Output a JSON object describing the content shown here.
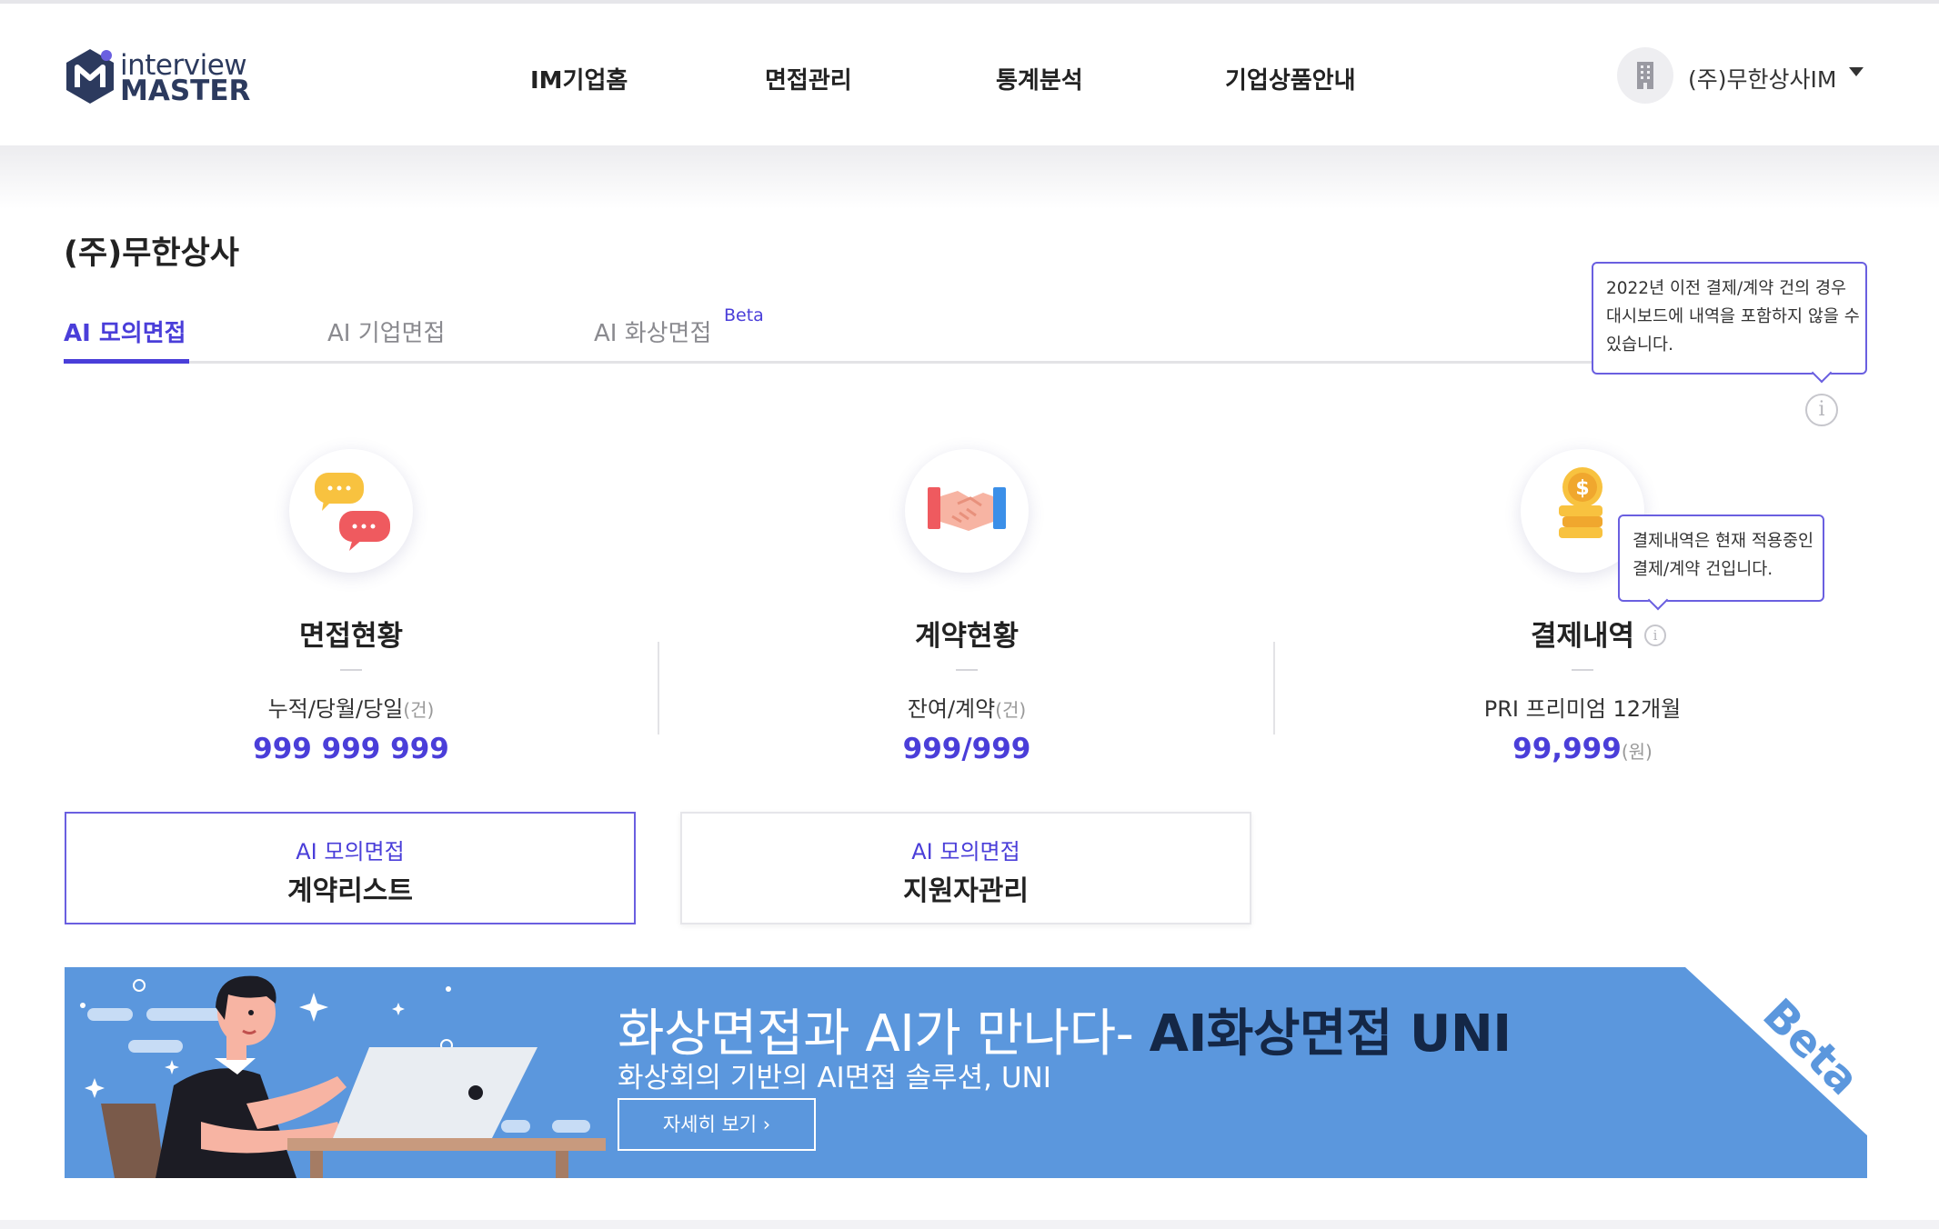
{
  "header": {
    "logo": {
      "line1": "interview",
      "line2": "MASTER"
    },
    "nav": [
      "IM기업홈",
      "면접관리",
      "통계분석",
      "기업상품안내"
    ],
    "account_name": "(주)무한상사IM"
  },
  "company_name": "(주)무한상사",
  "tabs": [
    {
      "label": "AI 모의면접",
      "active": true
    },
    {
      "label": "AI 기업면접",
      "active": false
    },
    {
      "label": "AI 화상면접",
      "active": false,
      "badge": "Beta"
    }
  ],
  "tooltips": {
    "dashboard_notice": [
      "2022년 이전 결제/계약 건의 경우",
      "대시보드에 내역을 포함하지 않을 수",
      "있습니다."
    ],
    "payment_notice": [
      "결제내역은 현재 적용중인",
      "결제/계약 건입니다."
    ]
  },
  "stats": [
    {
      "title": "면접현황",
      "subtitle": "누적/당월/당일",
      "sub_unit": "(건)",
      "value": "999 999 999",
      "value_unit": ""
    },
    {
      "title": "계약현황",
      "subtitle": "잔여/계약",
      "sub_unit": "(건)",
      "value": "999/999",
      "value_unit": ""
    },
    {
      "title": "결제내역",
      "subtitle": "PRI 프리미엄 12개월",
      "sub_unit": "",
      "value": "99,999",
      "value_unit": "(원)"
    }
  ],
  "buttons": [
    {
      "line1": "AI 모의면접",
      "line2": "계약리스트"
    },
    {
      "line1": "AI 모의면접",
      "line2": "지원자관리"
    }
  ],
  "banner": {
    "title_plain": "화상면접과 AI가 만나다- ",
    "title_bold": "AI화상면접 UNI",
    "subtitle": "화상회의 기반의 AI면접 솔루션, UNI",
    "button": "자세히 보기 ›",
    "ribbon": "Beta"
  },
  "colors": {
    "accent": "#4a3ed9",
    "banner_bg": "#5b97dd",
    "banner_bold_text": "#142746"
  }
}
